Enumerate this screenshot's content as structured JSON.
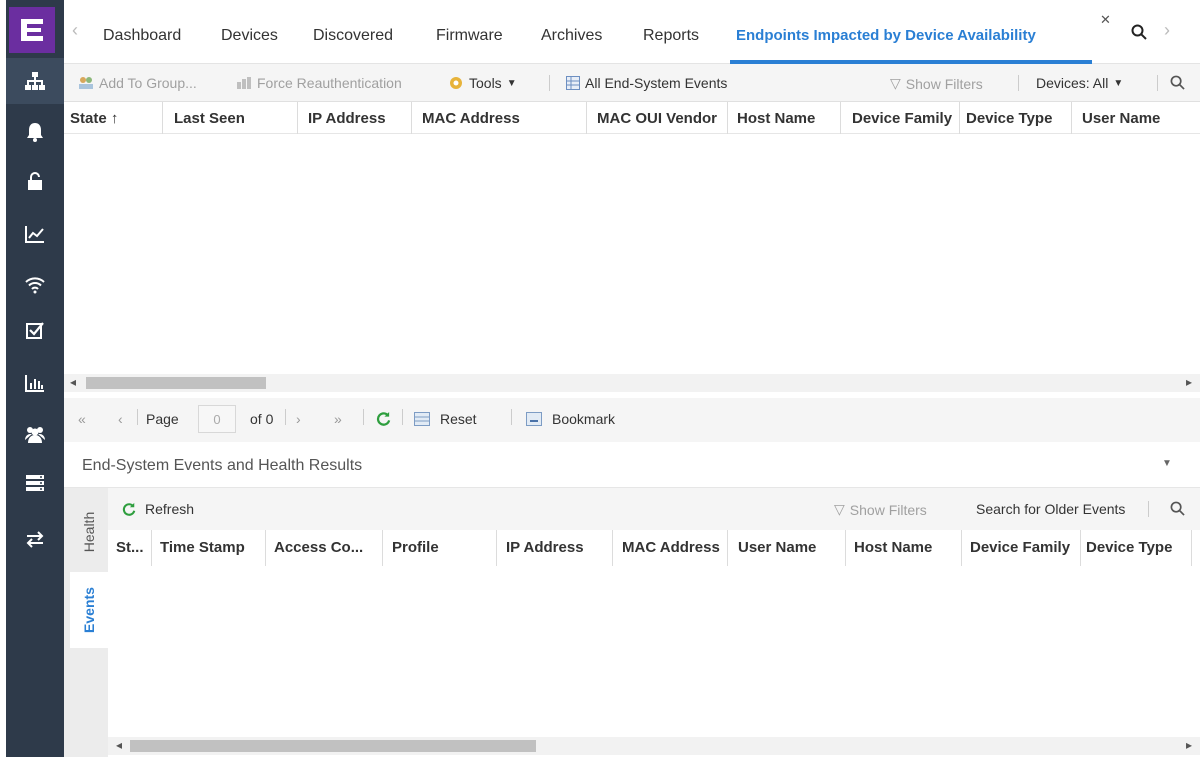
{
  "nav": {
    "items": [
      {
        "icon": "network-topology-icon"
      },
      {
        "icon": "bell-icon"
      },
      {
        "icon": "lock-icon"
      },
      {
        "icon": "line-chart-icon"
      },
      {
        "icon": "wifi-icon"
      },
      {
        "icon": "checklist-icon"
      },
      {
        "icon": "bar-chart-icon"
      },
      {
        "icon": "users-icon"
      },
      {
        "icon": "server-icon"
      },
      {
        "icon": "transfer-icon"
      }
    ]
  },
  "tabs": {
    "items": [
      "Dashboard",
      "Devices",
      "Discovered",
      "Firmware",
      "Archives",
      "Reports",
      "Endpoints Impacted by Device Availability"
    ],
    "active": "Endpoints Impacted by Device Availability"
  },
  "toolbar": {
    "add_to_group": "Add To Group...",
    "force_reauth": "Force Reauthentication",
    "tools": "Tools",
    "all_events": "All End-System Events",
    "show_filters": "Show Filters",
    "devices": "Devices: All"
  },
  "grid": {
    "columns": [
      "State",
      "Last Seen",
      "IP Address",
      "MAC Address",
      "MAC OUI Vendor",
      "Host Name",
      "Device Family",
      "Device Type",
      "User Name"
    ],
    "sort_indicator": "↑"
  },
  "pager": {
    "page_label": "Page",
    "page_value": "0",
    "of_label": "of 0",
    "reset": "Reset",
    "bookmark": "Bookmark"
  },
  "details": {
    "title": "End-System Events and Health Results",
    "vtabs": [
      "Health",
      "Events"
    ],
    "active_vtab": "Events",
    "refresh": "Refresh",
    "show_filters": "Show Filters",
    "search_older": "Search for Older Events",
    "columns": [
      "St...",
      "Time Stamp",
      "Access Co...",
      "Profile",
      "IP Address",
      "MAC Address",
      "User Name",
      "Host Name",
      "Device Family",
      "Device Type"
    ]
  },
  "colors": {
    "nav_bg": "#2e3a4a",
    "logo_bg": "#6b2ea0",
    "accent": "#2a7fd4",
    "refresh_green": "#2e9e3e"
  }
}
